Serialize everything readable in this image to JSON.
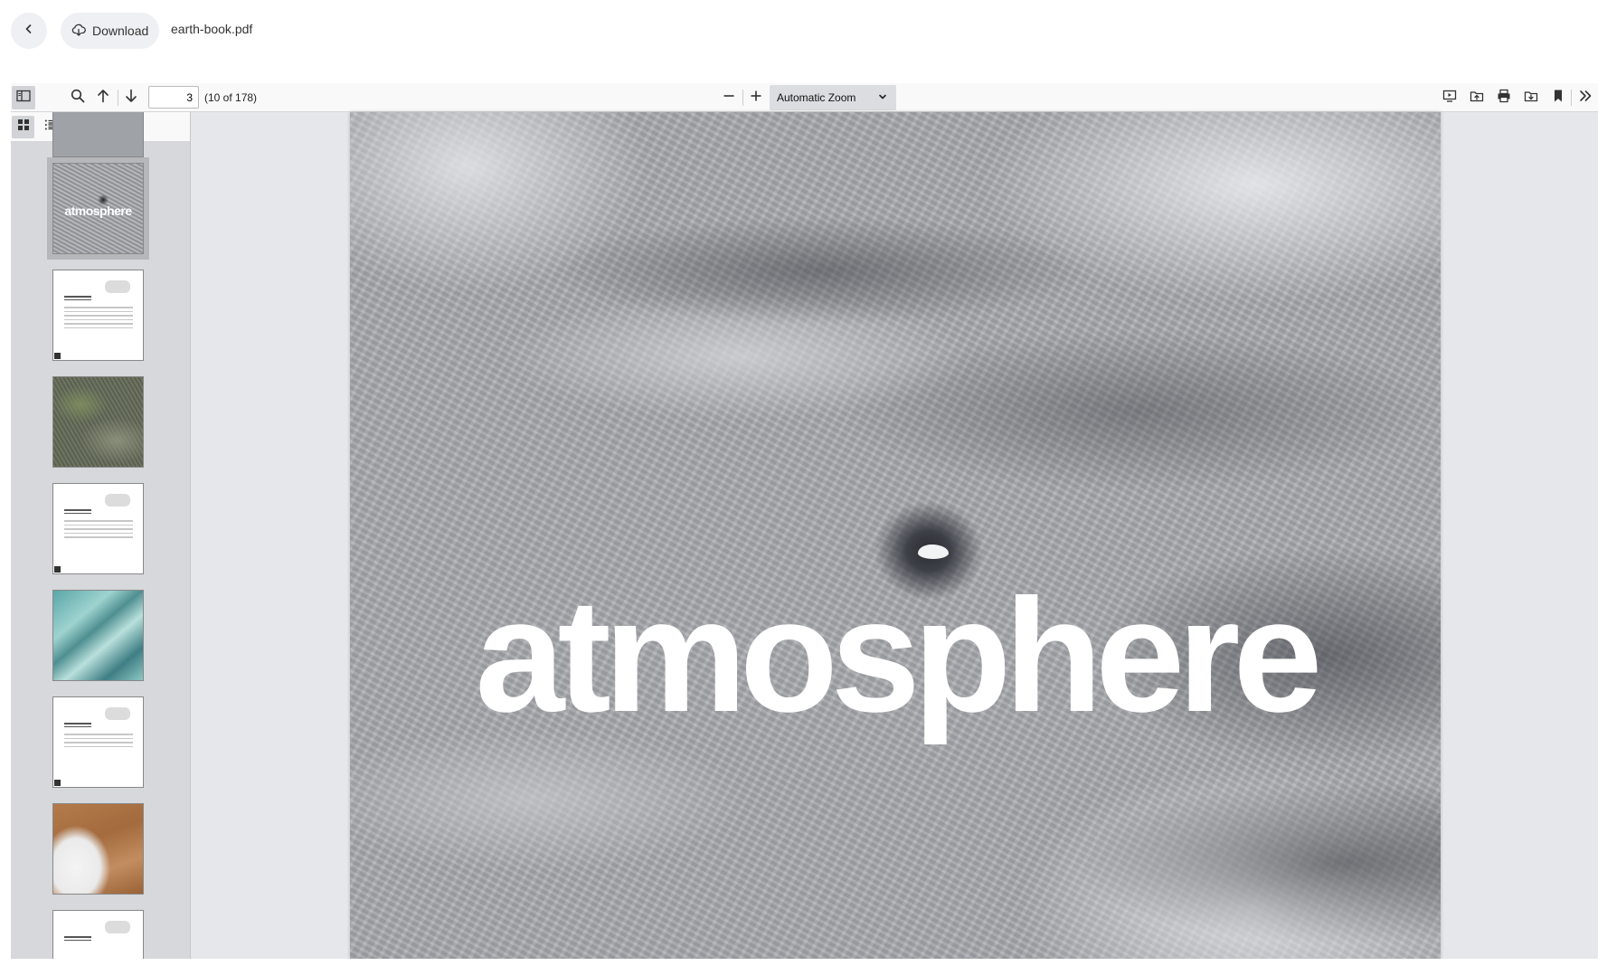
{
  "app": {
    "download_label": "Download",
    "filename": "earth-book.pdf"
  },
  "toolbar": {
    "page_number": "3",
    "page_count": "(10 of 178)",
    "zoom_selected": "Automatic Zoom"
  },
  "page": {
    "title_text": "atmosphere"
  },
  "thumbnails": [
    {
      "kind": "photo",
      "label": "atmosphere",
      "selected": true
    },
    {
      "kind": "text"
    },
    {
      "kind": "photo"
    },
    {
      "kind": "text"
    },
    {
      "kind": "photo"
    },
    {
      "kind": "text"
    },
    {
      "kind": "photo"
    },
    {
      "kind": "text"
    }
  ],
  "colors": {
    "toolbar_bg": "#f9f9fa",
    "sidebar_bg": "#d7d8db",
    "viewer_bg": "#e6e7ea",
    "button_bg": "#eef0f3"
  }
}
